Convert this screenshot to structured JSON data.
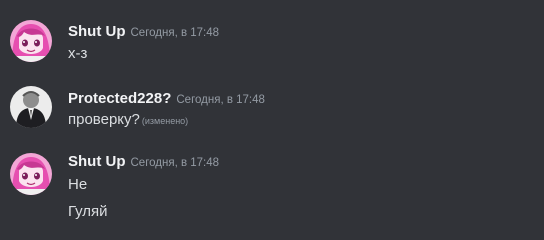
{
  "messages": [
    {
      "username": "Shut Up",
      "timestamp": "Сегодня, в 17:48",
      "avatar_icon": "anime-girl-avatar-icon",
      "lines": [
        "х-з"
      ]
    },
    {
      "username": "Protected228?",
      "timestamp": "Сегодня, в 17:48",
      "avatar_icon": "suited-figure-avatar-icon",
      "lines": [
        "проверку?"
      ],
      "edited_label": "(изменено)"
    },
    {
      "username": "Shut Up",
      "timestamp": "Сегодня, в 17:48",
      "avatar_icon": "anime-girl-avatar-icon",
      "lines": [
        "Не",
        "Гуляй"
      ]
    }
  ],
  "colors": {
    "background": "#313338",
    "username": "#f2f3f5",
    "message_text": "#dbdee1",
    "muted_text": "#949ba4",
    "avatar_pink": "#e64fb0"
  }
}
